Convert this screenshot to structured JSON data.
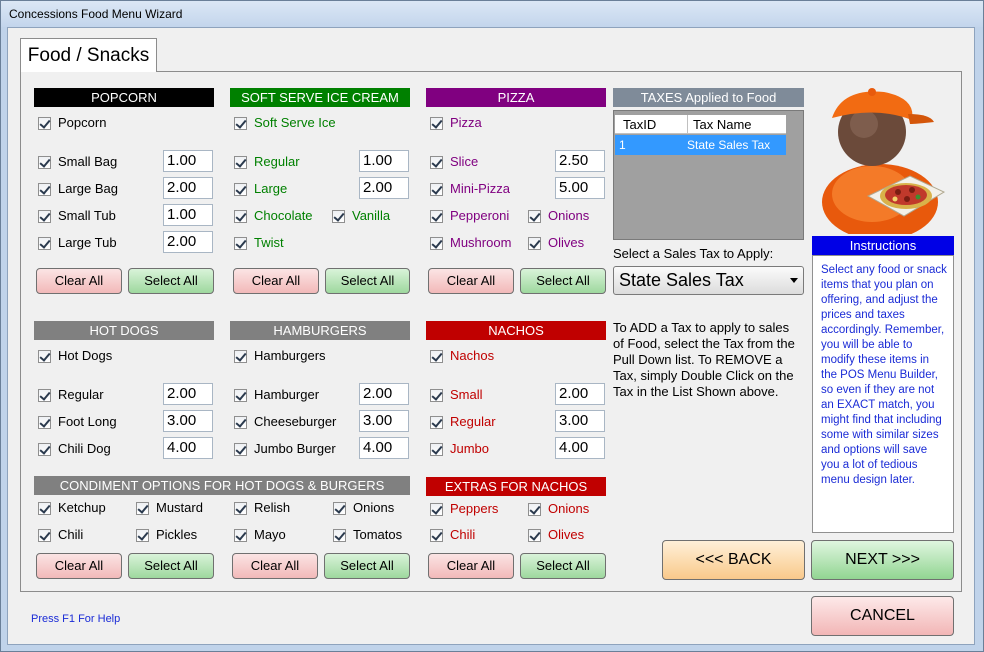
{
  "window": {
    "title": "Concessions Food Menu Wizard",
    "tab": "Food / Snacks"
  },
  "colors": {
    "popcorn": "#000000",
    "icecream": "#008000",
    "pizza": "#800080",
    "hotdogs": "#808080",
    "nachos": "#c00000",
    "instructions": "#0000e6"
  },
  "common": {
    "clear_all": "Clear All",
    "select_all": "Select All"
  },
  "popcorn": {
    "header": "POPCORN",
    "main": "Popcorn",
    "items": [
      {
        "label": "Small Bag",
        "price": "1.00"
      },
      {
        "label": "Large Bag",
        "price": "2.00"
      },
      {
        "label": "Small Tub",
        "price": "1.00"
      },
      {
        "label": "Large Tub",
        "price": "2.00"
      }
    ]
  },
  "icecream": {
    "header": "SOFT SERVE ICE CREAM",
    "main": "Soft Serve Ice",
    "items": [
      {
        "label": "Regular",
        "price": "1.00"
      },
      {
        "label": "Large",
        "price": "2.00"
      }
    ],
    "flavors": [
      "Chocolate",
      "Vanilla",
      "Twist"
    ]
  },
  "pizza": {
    "header": "PIZZA",
    "main": "Pizza",
    "items": [
      {
        "label": "Slice",
        "price": "2.50"
      },
      {
        "label": "Mini-Pizza",
        "price": "5.00"
      }
    ],
    "toppings": [
      "Pepperoni",
      "Onions",
      "Mushroom",
      "Olives"
    ]
  },
  "hotdogs": {
    "header": "HOT DOGS",
    "main": "Hot Dogs",
    "items": [
      {
        "label": "Regular",
        "price": "2.00"
      },
      {
        "label": "Foot Long",
        "price": "3.00"
      },
      {
        "label": "Chili Dog",
        "price": "4.00"
      }
    ]
  },
  "hamburgers": {
    "header": "HAMBURGERS",
    "main": "Hamburgers",
    "items": [
      {
        "label": "Hamburger",
        "price": "2.00"
      },
      {
        "label": "Cheeseburger",
        "price": "3.00"
      },
      {
        "label": "Jumbo Burger",
        "price": "4.00"
      }
    ]
  },
  "nachos": {
    "header": "NACHOS",
    "main": "Nachos",
    "items": [
      {
        "label": "Small",
        "price": "2.00"
      },
      {
        "label": "Regular",
        "price": "3.00"
      },
      {
        "label": "Jumbo",
        "price": "4.00"
      }
    ]
  },
  "condiments": {
    "header": "CONDIMENT OPTIONS FOR HOT DOGS & BURGERS",
    "items": [
      "Ketchup",
      "Mustard",
      "Relish",
      "Onions",
      "Chili",
      "Pickles",
      "Mayo",
      "Tomatos"
    ]
  },
  "extras": {
    "header": "EXTRAS FOR NACHOS",
    "items": [
      "Peppers",
      "Onions",
      "Chili",
      "Olives"
    ]
  },
  "taxes": {
    "header": "TAXES Applied to Food",
    "columns": [
      "TaxID",
      "Tax Name"
    ],
    "rows": [
      {
        "id": "1",
        "name": "State Sales Tax"
      }
    ],
    "select_label": "Select a Sales Tax to Apply:",
    "selected": "State Sales Tax",
    "help_text": "To ADD a Tax to apply to sales of Food, select the Tax from the Pull Down list.  To REMOVE a Tax, simply Double Click on the Tax in the List Shown above."
  },
  "instructions": {
    "header": "Instructions",
    "text": "Select any food or snack items that you plan on offering, and adjust the prices and taxes accordingly. Remember, you will be able to modify these items in the POS Menu Builder, so even if they are not an EXACT match, you might find that including some with similar sizes and options will save you a lot of tedious menu design later."
  },
  "nav": {
    "back": "<<< BACK",
    "next": "NEXT >>>",
    "cancel": "CANCEL"
  },
  "help": "Press F1 For Help"
}
